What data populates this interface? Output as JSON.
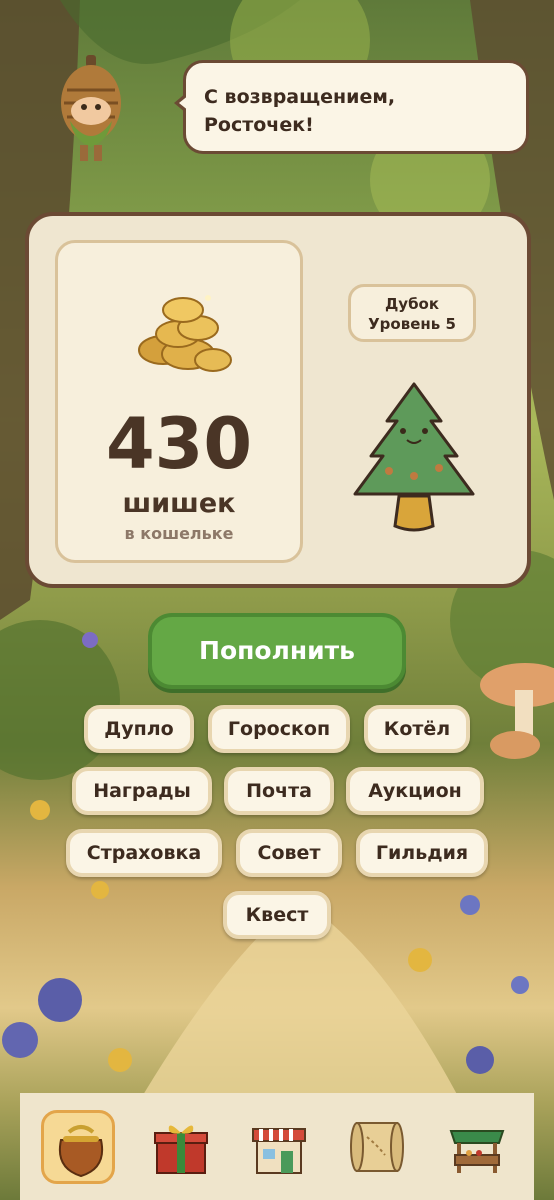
{
  "greeting": {
    "text_line1": "С возвращением,",
    "text_line2": "Росточек!"
  },
  "wallet": {
    "amount": "430",
    "unit": "шишек",
    "caption": "в кошельке",
    "level_name": "Дубок",
    "level_label": "Уровень 5"
  },
  "topup_button": "Пополнить",
  "menu": [
    "Дупло",
    "Гороскоп",
    "Котёл",
    "Награды",
    "Почта",
    "Аукцион",
    "Страховка",
    "Совет",
    "Гильдия",
    "Квест"
  ],
  "nav": {
    "items": [
      "purse-icon",
      "gift-icon",
      "shop-icon",
      "map-scroll-icon",
      "market-stall-icon"
    ],
    "active": 0
  },
  "colors": {
    "accent_green": "#64a845",
    "frame_brown": "#6b4a34",
    "panel_cream": "#efe6d0"
  }
}
